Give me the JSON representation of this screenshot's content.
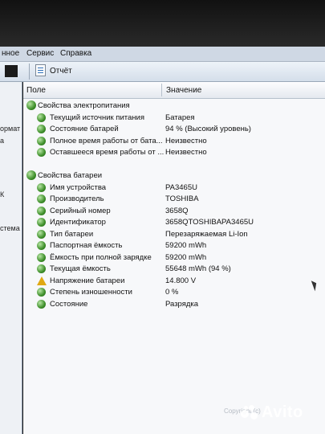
{
  "menu": {
    "items": [
      "нное",
      "Сервис",
      "Справка"
    ]
  },
  "toolbar": {
    "report_label": "Отчёт"
  },
  "columns": {
    "field": "Поле",
    "value": "Значение"
  },
  "left_fragments": [
    "ормат",
    "а",
    "К",
    "стема"
  ],
  "rows": [
    {
      "label": "Свойства электропитания",
      "value": "",
      "type": "group"
    },
    {
      "label": "Текущий источник питания",
      "value": "Батарея",
      "type": "item"
    },
    {
      "label": "Состояние батарей",
      "value": "94 % (Высокий уровень)",
      "type": "item"
    },
    {
      "label": "Полное время работы от бата...",
      "value": "Неизвестно",
      "type": "item"
    },
    {
      "label": "Оставшееся время работы от ...",
      "value": "Неизвестно",
      "type": "item"
    },
    {
      "label": "",
      "value": "",
      "type": "spacer"
    },
    {
      "label": "Свойства батареи",
      "value": "",
      "type": "group"
    },
    {
      "label": "Имя устройства",
      "value": "PA3465U",
      "type": "item"
    },
    {
      "label": "Производитель",
      "value": "TOSHIBA",
      "type": "item"
    },
    {
      "label": "Серийный номер",
      "value": "3658Q",
      "type": "item"
    },
    {
      "label": "Идентификатор",
      "value": "3658QTOSHIBAPA3465U",
      "type": "item"
    },
    {
      "label": "Тип батареи",
      "value": "Перезаряжаемая Li-Ion",
      "type": "item"
    },
    {
      "label": "Паспортная ёмкость",
      "value": "59200 mWh",
      "type": "item"
    },
    {
      "label": "Ёмкость при полной зарядке",
      "value": "59200 mWh",
      "type": "item"
    },
    {
      "label": "Текущая ёмкость",
      "value": "55648 mWh  (94 %)",
      "type": "item"
    },
    {
      "label": "Напряжение батареи",
      "value": "14.800 V",
      "type": "warn"
    },
    {
      "label": "Степень изношенности",
      "value": "0 %",
      "type": "item"
    },
    {
      "label": "Состояние",
      "value": "Разрядка",
      "type": "item"
    }
  ],
  "footer": {
    "copyright": "Copyright (c)"
  },
  "watermark": {
    "text": "Avito"
  }
}
